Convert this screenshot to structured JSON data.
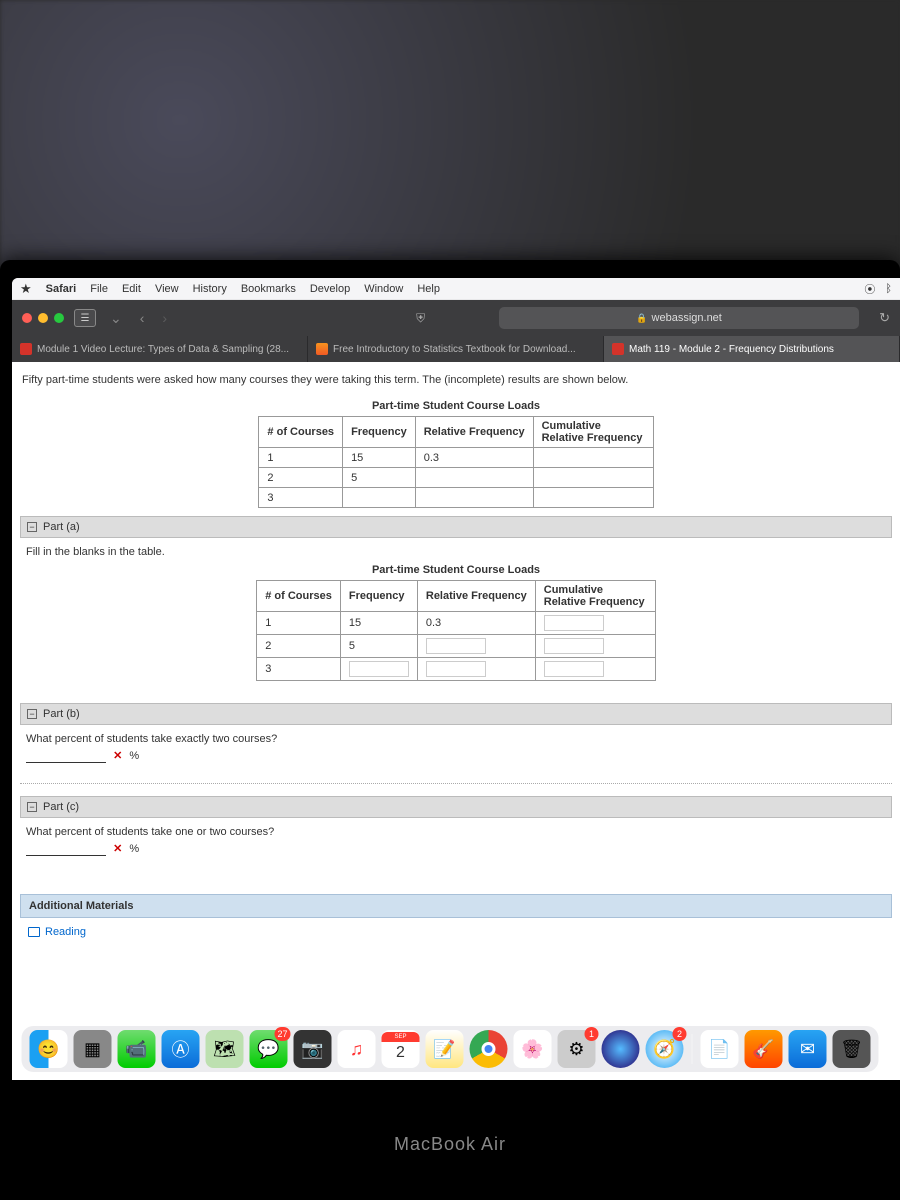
{
  "menubar": {
    "app": "Safari",
    "items": [
      "File",
      "Edit",
      "View",
      "History",
      "Bookmarks",
      "Develop",
      "Window",
      "Help"
    ]
  },
  "toolbar": {
    "url_host": "webassign.net"
  },
  "tabs": [
    {
      "label": "Module 1 Video Lecture: Types of Data & Sampling (28...",
      "active": false
    },
    {
      "label": "Free Introductory to Statistics Textbook for Download...",
      "active": false
    },
    {
      "label": "Math 119 - Module 2 - Frequency Distributions",
      "active": true
    }
  ],
  "content": {
    "intro": "Fifty part-time students were asked how many courses they were taking this term. The (incomplete) results are shown below.",
    "table_caption": "Part-time Student Course Loads",
    "headers": {
      "courses": "# of Courses",
      "freq": "Frequency",
      "relfreq": "Relative Frequency",
      "cumrel": "Cumulative Relative Frequency"
    },
    "rows": [
      {
        "courses": "1",
        "freq": "15",
        "relfreq": "0.3",
        "cumrel": ""
      },
      {
        "courses": "2",
        "freq": "5",
        "relfreq": "",
        "cumrel": ""
      },
      {
        "courses": "3",
        "freq": "",
        "relfreq": "",
        "cumrel": ""
      }
    ],
    "part_a": {
      "title": "Part (a)",
      "prompt": "Fill in the blanks in the table."
    },
    "part_b": {
      "title": "Part (b)",
      "prompt": "What percent of students take exactly two courses?",
      "unit": "%"
    },
    "part_c": {
      "title": "Part (c)",
      "prompt": "What percent of students take one or two courses?",
      "unit": "%"
    },
    "additional": "Additional Materials",
    "reading": "Reading"
  },
  "dock": {
    "messages_badge": "27",
    "calendar_month": "SEP",
    "calendar_day": "2",
    "sysprefs_badge": "1",
    "mail_badge": "2"
  },
  "laptop_label": "MacBook Air"
}
